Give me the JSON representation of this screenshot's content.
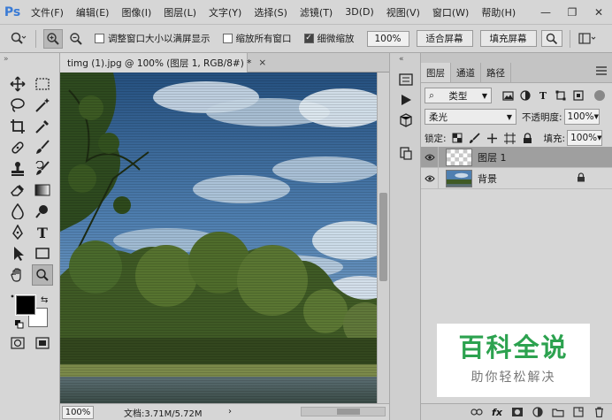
{
  "app": {
    "logo": "Ps"
  },
  "menu": [
    "文件(F)",
    "编辑(E)",
    "图像(I)",
    "图层(L)",
    "文字(Y)",
    "选择(S)",
    "滤镜(T)",
    "3D(D)",
    "视图(V)",
    "窗口(W)",
    "帮助(H)"
  ],
  "window_controls": {
    "minimize": "—",
    "restore": "❐",
    "close": "✕"
  },
  "options": {
    "resize_windows_label": "调整窗口大小以满屏显示",
    "zoom_all_label": "缩放所有窗口",
    "scrubby_zoom_label": "细微缩放",
    "zoom_value": "100%",
    "fit_screen": "适合屏幕",
    "fill_screen": "填充屏幕"
  },
  "document": {
    "tab_title": "timg (1).jpg @ 100% (图层 1, RGB/8#) *",
    "tab_close": "×",
    "status_zoom": "100%",
    "status_doc": "文档:3.71M/5.72M"
  },
  "panel": {
    "tabs": [
      "图层",
      "通道",
      "路径"
    ],
    "filter_kind": "类型",
    "blend_mode": "柔光",
    "opacity_label": "不透明度:",
    "opacity_value": "100%",
    "lock_label": "锁定:",
    "fill_label": "填充:",
    "fill_value": "100%",
    "layers": [
      {
        "name": "图层 1",
        "selected": true,
        "locked": false
      },
      {
        "name": "背景",
        "selected": false,
        "locked": true
      }
    ],
    "bottom_fx": "fx"
  },
  "watermark": {
    "title": "百科全说",
    "subtitle": "助你轻松解决"
  },
  "colors": {
    "foreground": "#000000",
    "background": "#ffffff",
    "watermark_green": "#2ca24f"
  }
}
